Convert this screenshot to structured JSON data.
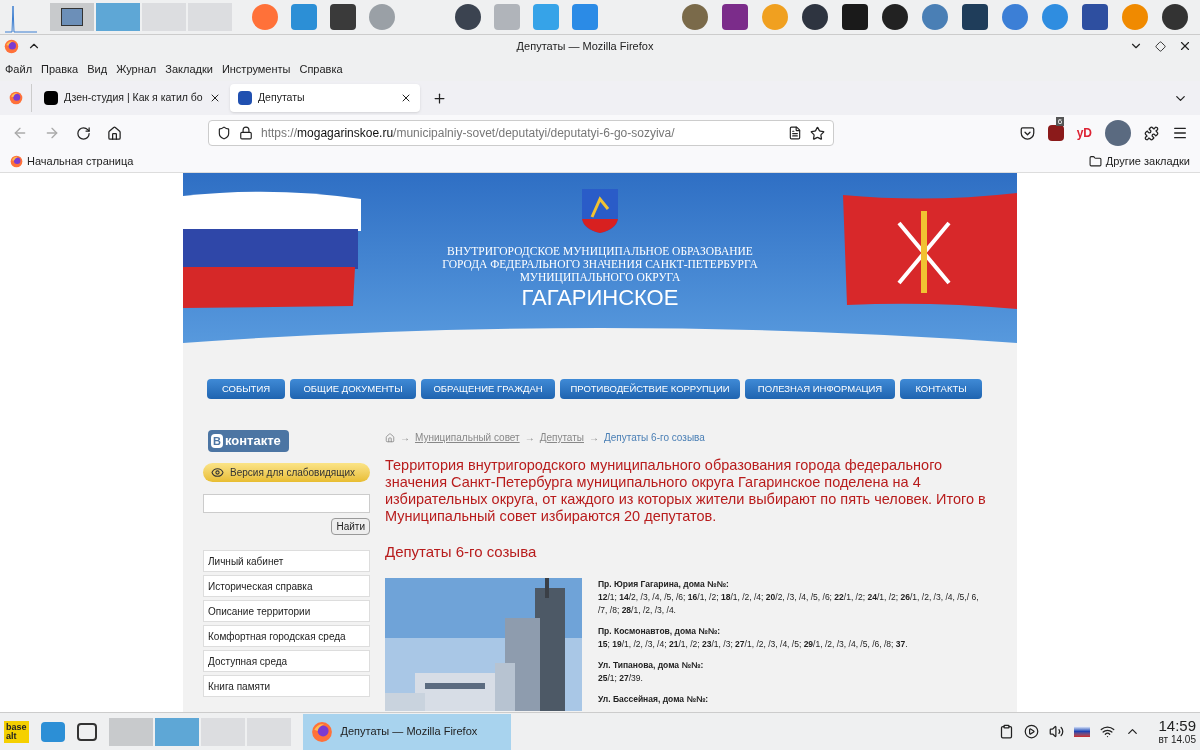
{
  "window": {
    "title": "Депутаты — Mozilla Firefox"
  },
  "menu": [
    "Файл",
    "Правка",
    "Вид",
    "Журнал",
    "Закладки",
    "Инструменты",
    "Справка"
  ],
  "tabs": [
    {
      "label": "Дзен-студия | Как я катил бо",
      "selected": false
    },
    {
      "label": "Депутаты",
      "selected": true
    }
  ],
  "address": {
    "scheme": "https://",
    "host": "mogagarinskoe.ru",
    "path": "/municipalniy-sovet/deputatyi/deputatyi-6-go-sozyiva/"
  },
  "extensions": {
    "badge": "6",
    "yd": "yD"
  },
  "bookmarks": {
    "items": [
      "Начальная страница"
    ],
    "other": "Другие закладки"
  },
  "site": {
    "header_lines": [
      "ВНУТРИГОРОДСКОЕ МУНИЦИПАЛЬНОЕ ОБРАЗОВАНИЕ",
      "ГОРОДА ФЕДЕРАЛЬНОГО ЗНАЧЕНИЯ САНКТ-ПЕТЕРБУРГА",
      "МУНИЦИПАЛЬНОГО ОКРУГА"
    ],
    "name": "ГАГАРИНСКОЕ",
    "nav": [
      "СОБЫТИЯ",
      "ОБЩИЕ ДОКУМЕНТЫ",
      "ОБРАЩЕНИЕ ГРАЖДАН",
      "ПРОТИВОДЕЙСТВИЕ КОРРУПЦИИ",
      "ПОЛЕЗНАЯ ИНФОРМАЦИЯ",
      "КОНТАКТЫ"
    ],
    "vk": {
      "letter": "В",
      "text": "контакте"
    },
    "accessibility": "Версия для слабовидящих",
    "search_button": "Найти",
    "sidebar": [
      "Личный кабинет",
      "Историческая справка",
      "Описание территории",
      "Комфортная городская среда",
      "Доступная среда",
      "Книга памяти"
    ],
    "breadcrumb": {
      "separator": "→",
      "links": [
        "Муниципальный совет",
        "Депутаты"
      ],
      "current": "Депутаты 6-го созыва"
    },
    "intro": "Территория внутригородского муниципального образования города федерального значения Санкт-Петербурга муниципального округа Гагаринское поделена на 4 избирательных округа, от каждого из которых жители выбирают по пять человек. Итого в Муниципальный совет избираются 20 депутатов.",
    "heading": "Депутаты 6-го созыва",
    "addresses": [
      {
        "title": "Пр. Юрия Гагарина, дома №№:",
        "houses": "**12**/1; **14**/2, /3, /4, /5, /6; **16**/1, /2; **18**/1, /2, /4; **20**/2, /3, /4, /5, /6; **22**/1, /2; **24**/1, /2; **26**/1, /2, /3, /4, /5,/ 6, /7, /8; **28**/1, /2, /3, /4."
      },
      {
        "title": "Пр. Космонавтов, дома №№:",
        "houses": "**15**; **19**/1, /2, /3, /4; **21**/1, /2; **23**/1, /3; **27**/1, /2, /3, /4, /5; **29**/1, /2, /3, /4, /5, /6, /8; **37**."
      },
      {
        "title": "Ул. Типанова, дома №№:",
        "houses": "**25**/1; **27**/39."
      },
      {
        "title": "Ул. Бассейная, дома №№:"
      }
    ]
  },
  "taskbar": {
    "logo": [
      "base",
      "alt"
    ],
    "task": "Депутаты — Mozilla Firefox",
    "time": "14:59",
    "date": "вт 14.05"
  }
}
